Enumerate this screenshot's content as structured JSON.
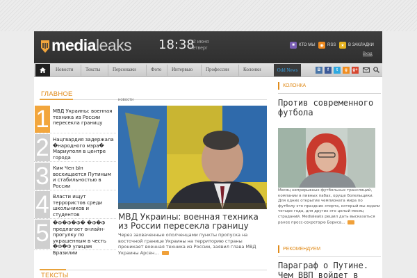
{
  "header": {
    "logo_strong": "media",
    "logo_light": "leaks",
    "time": "18:38",
    "date_line1": "12 июня",
    "date_line2": "четверг",
    "btn_about": "КТО МЫ",
    "btn_rss": "RSS",
    "btn_bookmarks": "В ЗАКЛАДКИ",
    "login": "Вход"
  },
  "nav": {
    "items": [
      "Новости",
      "Тексты",
      "Персонажи",
      "Фото",
      "Интервью",
      "Профессии",
      "Колонки"
    ],
    "odd_news": "Odd News",
    "social": [
      "B",
      "f",
      "t",
      "g",
      "g+"
    ]
  },
  "main": {
    "section_title": "ГЛАВНОЕ",
    "items": [
      {
        "num": "1",
        "text": "МВД Украины: военная техника из России пересекла границу"
      },
      {
        "num": "2",
        "text": "Нацгвардия задержала �народного мэра� Мариуполя в центре города"
      },
      {
        "num": "3",
        "text": "Ким Чен Ын восхищается Путиным и стабильностью в России"
      },
      {
        "num": "4",
        "text": "Власти ищут террористов среди школьников и студентов"
      },
      {
        "num": "5",
        "text": "�Ф�Ф�Ф� �Ф�Ф предлагает онлайн-прогулку по украшенным в честь �Ф�Ф улицам Бразилии"
      }
    ],
    "texts_title": "ТЕКСТЫ"
  },
  "feature": {
    "label": "НОВОСТИ",
    "title": "МВД Украины: военная техника из России пересекла границу",
    "desc": "Через захваченные ополченцами пункты пропуска на восточной границе Украины на территорию страны проникает военная техника из России, заявил глава МВД Украины Арсен…"
  },
  "column": {
    "tag": "КОЛОНКА",
    "title": "Против современного футбола",
    "desc": "Месяц непрерывных футбольных трансляций, компании в пивных пабах, оруще болельщики. Для одних открытие чемпионата мира по футболу это праздник спорта, который мы ждали четыре года, для других это целый месяц страданий. Medialeaks решил дать высказаться ранее пресс-секретарю Бориса…"
  },
  "recommended": {
    "tag": "РЕКОМЕНДУЕМ",
    "title": "Параграф о Путине. Чем ВВП войдет в"
  },
  "colors": {
    "accent": "#e08b1a",
    "header_bg": "#353535",
    "odd_news": "#37a3e6"
  }
}
